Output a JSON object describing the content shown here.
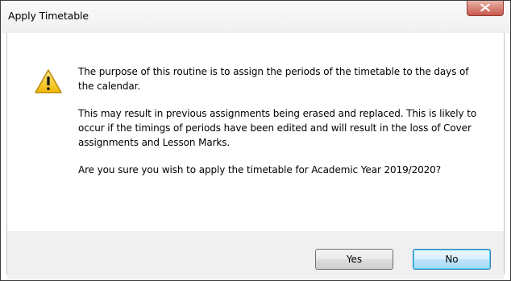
{
  "window": {
    "title": "Apply Timetable"
  },
  "message": {
    "paragraph1": "The purpose of this routine is to assign the periods of the timetable to the days of the calendar.",
    "paragraph2": "This may result in previous assignments being erased and replaced. This is likely to occur if the timings of periods have been edited and will result in the loss of Cover assignments and Lesson Marks.",
    "paragraph3": "Are you sure you wish to apply the timetable for Academic Year 2019/2020?"
  },
  "buttons": {
    "yes": "Yes",
    "no": "No"
  },
  "icons": {
    "warning": "warning-triangle-icon",
    "close": "close-icon"
  },
  "colors": {
    "close_button": "#c9574b",
    "warning": "#f5c211",
    "default_button_border": "#3c7fb1"
  }
}
